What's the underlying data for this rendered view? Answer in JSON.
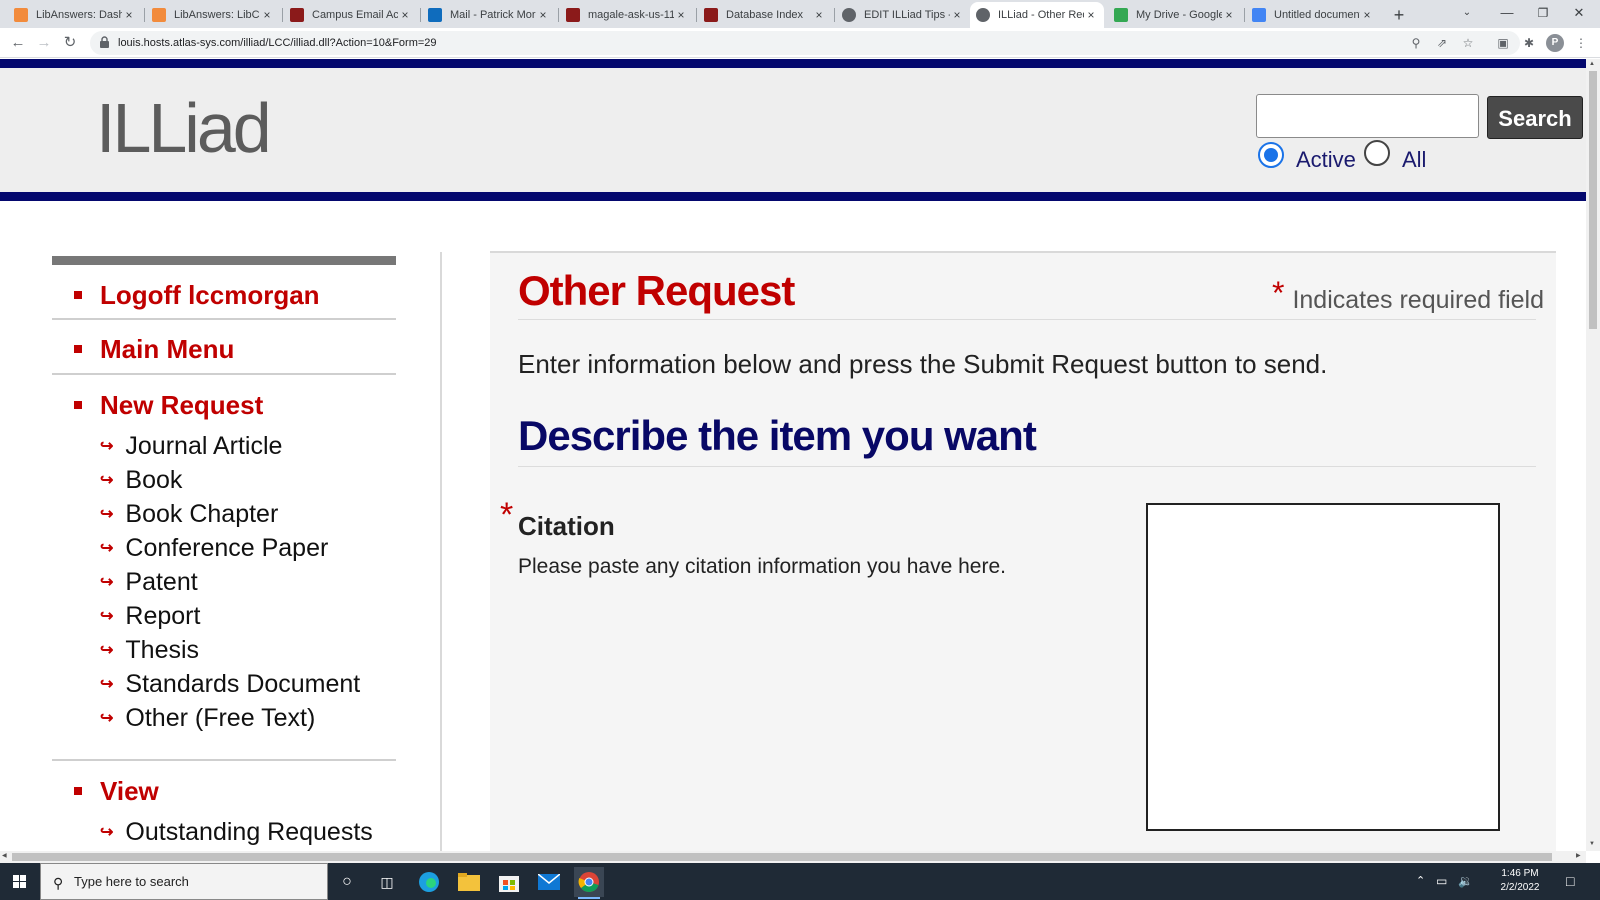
{
  "browser": {
    "tabs": [
      {
        "title": "LibAnswers: Dashb",
        "favicon_color": "#f28b3c"
      },
      {
        "title": "LibAnswers: LibCha",
        "favicon_color": "#f28b3c"
      },
      {
        "title": "Campus Email Acc",
        "favicon_color": "#8b1a1a"
      },
      {
        "title": "Mail - Patrick Morg",
        "favicon_color": "#0f6cbd"
      },
      {
        "title": "magale-ask-us-11",
        "favicon_color": "#8b1a1a"
      },
      {
        "title": "Database Index",
        "favicon_color": "#8b1a1a"
      },
      {
        "title": "EDIT ILLiad Tips - S",
        "favicon_color": "#5f6368"
      },
      {
        "title": "ILLiad - Other Req",
        "favicon_color": "#5f6368",
        "active": true
      },
      {
        "title": "My Drive - Google",
        "favicon_color": "#34a853"
      },
      {
        "title": "Untitled document",
        "favicon_color": "#4285f4"
      }
    ],
    "tab_close": "×",
    "new_tab": "+",
    "url": "louis.hosts.atlas-sys.com/illiad/LCC/illiad.dll?Action=10&Form=29",
    "avatar_letter": "P"
  },
  "header": {
    "logo": "ILLiad",
    "search_button": "Search",
    "search_value": "",
    "radio_active_label": "Active",
    "radio_all_label": "All",
    "radio_selected": "Active"
  },
  "sidebar": {
    "logoff": "Logoff lccmorgan",
    "main_menu": "Main Menu",
    "new_request": "New Request",
    "new_request_items": [
      "Journal Article",
      "Book",
      "Book Chapter",
      "Conference Paper",
      "Patent",
      "Report",
      "Thesis",
      "Standards Document",
      "Other (Free Text)"
    ],
    "view": "View",
    "view_items": [
      "Outstanding Requests"
    ]
  },
  "main": {
    "title": "Other Request",
    "required_star": "*",
    "required_note": "Indicates required field",
    "intro": "Enter information below and press the Submit Request button to send.",
    "section_title": "Describe the item you want",
    "citation_label": "Citation",
    "citation_help": "Please paste any citation information you have here.",
    "citation_value": ""
  },
  "taskbar": {
    "search_placeholder": "Type here to search",
    "time": "1:46 PM",
    "date": "2/2/2022"
  },
  "colors": {
    "brand_navy": "#04086e",
    "accent_red": "#c00000",
    "section_navy": "#080866"
  }
}
